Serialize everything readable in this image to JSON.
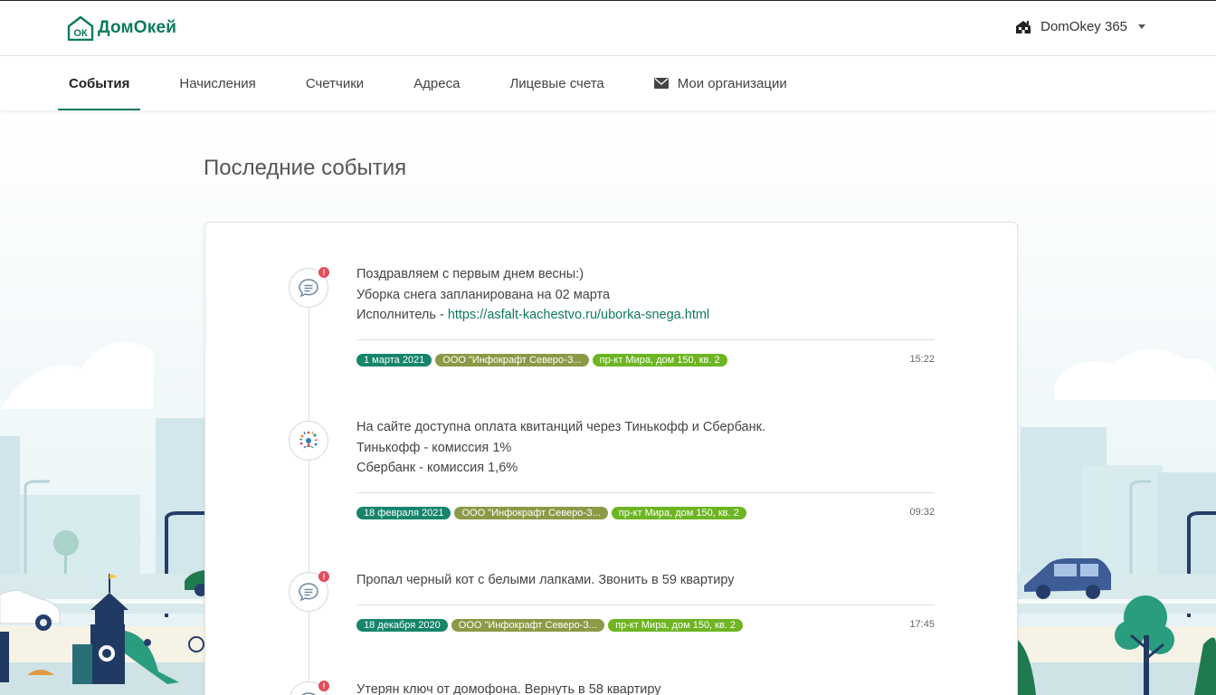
{
  "header": {
    "logo_text": "ДомОкей",
    "logo_mark": "ОК",
    "account_name": "DomOkey 365"
  },
  "nav": {
    "tabs": [
      {
        "label": "События",
        "active": true
      },
      {
        "label": "Начисления",
        "active": false
      },
      {
        "label": "Счетчики",
        "active": false
      },
      {
        "label": "Адреса",
        "active": false
      },
      {
        "label": "Лицевые счета",
        "active": false
      },
      {
        "label": "Мои организации",
        "active": false,
        "icon": "envelope-icon"
      }
    ]
  },
  "main": {
    "title": "Последние события"
  },
  "events": [
    {
      "icon": "chat-icon",
      "badge": "!",
      "lines": [
        "Поздравляем с первым днем весны:)",
        "Уборка снега запланирована на 02 марта"
      ],
      "link_prefix": "Исполнитель - ",
      "link_text": "https://asfalt-kachestvo.ru/uborka-snega.html",
      "date": "1 марта 2021",
      "org": "ООО \"Инфокрафт Северо-З...",
      "address": "пр-кт Мира, дом 150, кв. 2",
      "time": "15:22"
    },
    {
      "icon": "confetti-icon",
      "lines": [
        "На сайте доступна оплата квитанций через Тинькофф и Сбербанк.",
        "Тинькофф - комиссия 1%",
        "Сбербанк - комиссия 1,6%"
      ],
      "date": "18 февраля 2021",
      "org": "ООО \"Инфокрафт Северо-З...",
      "address": "пр-кт Мира, дом 150, кв. 2",
      "time": "09:32"
    },
    {
      "icon": "chat-icon",
      "badge": "!",
      "lines": [
        "Пропал черный кот с белыми лапками. Звонить в 59 квартиру"
      ],
      "date": "18 декабря 2020",
      "org": "ООО \"Инфокрафт Северо-З...",
      "address": "пр-кт Мира, дом 150, кв. 2",
      "time": "17:45"
    },
    {
      "icon": "chat-icon",
      "badge": "!",
      "lines": [
        "Утерян ключ от домофона. Вернуть в 58 квартиру"
      ]
    }
  ],
  "colors": {
    "brand": "#0d7a5f",
    "date_pill": "#16856b",
    "org_pill": "#8a9a46",
    "address_pill": "#6db522",
    "badge": "#e14d5a"
  }
}
